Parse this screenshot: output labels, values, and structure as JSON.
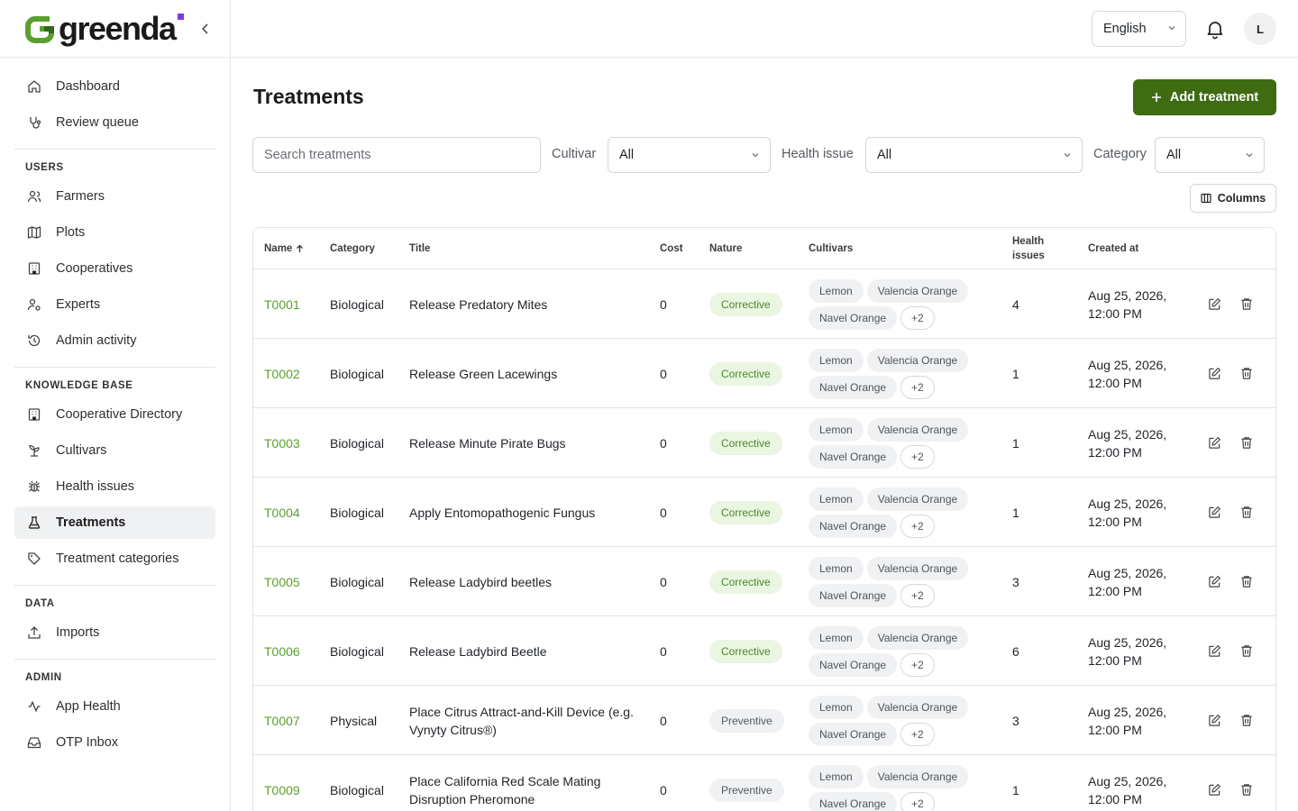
{
  "brand": {
    "name": "greenda"
  },
  "sidebar": {
    "top_items": [
      {
        "label": "Dashboard",
        "icon": "home-icon"
      },
      {
        "label": "Review queue",
        "icon": "stethoscope-icon"
      }
    ],
    "sections": [
      {
        "heading": "USERS",
        "items": [
          {
            "label": "Farmers",
            "icon": "users-icon"
          },
          {
            "label": "Plots",
            "icon": "map-icon"
          },
          {
            "label": "Cooperatives",
            "icon": "building-icon"
          },
          {
            "label": "Experts",
            "icon": "user-cog-icon"
          },
          {
            "label": "Admin activity",
            "icon": "history-icon"
          }
        ]
      },
      {
        "heading": "KNOWLEDGE BASE",
        "items": [
          {
            "label": "Cooperative Directory",
            "icon": "building-icon"
          },
          {
            "label": "Cultivars",
            "icon": "sprout-icon"
          },
          {
            "label": "Health issues",
            "icon": "bug-icon"
          },
          {
            "label": "Treatments",
            "icon": "flask-icon",
            "active": true
          },
          {
            "label": "Treatment categories",
            "icon": "tag-icon"
          }
        ]
      },
      {
        "heading": "DATA",
        "items": [
          {
            "label": "Imports",
            "icon": "upload-icon"
          }
        ]
      },
      {
        "heading": "ADMIN",
        "items": [
          {
            "label": "App Health",
            "icon": "activity-icon"
          },
          {
            "label": "OTP Inbox",
            "icon": "inbox-icon"
          }
        ]
      }
    ]
  },
  "topbar": {
    "language": "English",
    "avatar_initial": "L"
  },
  "page": {
    "title": "Treatments",
    "add_label": "Add treatment"
  },
  "filters": {
    "search_placeholder": "Search treatments",
    "cultivar_label": "Cultivar",
    "cultivar_value": "All",
    "health_label": "Health issue",
    "health_value": "All",
    "category_label": "Category",
    "category_value": "All",
    "columns_label": "Columns"
  },
  "table": {
    "headers": {
      "name": "Name",
      "category": "Category",
      "title": "Title",
      "cost": "Cost",
      "nature": "Nature",
      "cultivars": "Cultivars",
      "health": "Health issues",
      "created": "Created at"
    },
    "rows": [
      {
        "name": "T0001",
        "category": "Biological",
        "title": "Release Predatory Mites",
        "cost": "0",
        "nature": "Corrective",
        "cultivars": [
          "Lemon",
          "Valencia Orange",
          "Navel Orange"
        ],
        "more": "+2",
        "health": "4",
        "date": "Aug 25, 2026,",
        "time": "12:00 PM"
      },
      {
        "name": "T0002",
        "category": "Biological",
        "title": "Release Green Lacewings",
        "cost": "0",
        "nature": "Corrective",
        "cultivars": [
          "Lemon",
          "Valencia Orange",
          "Navel Orange"
        ],
        "more": "+2",
        "health": "1",
        "date": "Aug 25, 2026,",
        "time": "12:00 PM"
      },
      {
        "name": "T0003",
        "category": "Biological",
        "title": "Release Minute Pirate Bugs",
        "cost": "0",
        "nature": "Corrective",
        "cultivars": [
          "Lemon",
          "Valencia Orange",
          "Navel Orange"
        ],
        "more": "+2",
        "health": "1",
        "date": "Aug 25, 2026,",
        "time": "12:00 PM"
      },
      {
        "name": "T0004",
        "category": "Biological",
        "title": "Apply Entomopathogenic Fungus",
        "cost": "0",
        "nature": "Corrective",
        "cultivars": [
          "Lemon",
          "Valencia Orange",
          "Navel Orange"
        ],
        "more": "+2",
        "health": "1",
        "date": "Aug 25, 2026,",
        "time": "12:00 PM"
      },
      {
        "name": "T0005",
        "category": "Biological",
        "title": "Release Ladybird beetles",
        "cost": "0",
        "nature": "Corrective",
        "cultivars": [
          "Lemon",
          "Valencia Orange",
          "Navel Orange"
        ],
        "more": "+2",
        "health": "3",
        "date": "Aug 25, 2026,",
        "time": "12:00 PM"
      },
      {
        "name": "T0006",
        "category": "Biological",
        "title": "Release Ladybird Beetle",
        "cost": "0",
        "nature": "Corrective",
        "cultivars": [
          "Lemon",
          "Valencia Orange",
          "Navel Orange"
        ],
        "more": "+2",
        "health": "6",
        "date": "Aug 25, 2026,",
        "time": "12:00 PM"
      },
      {
        "name": "T0007",
        "category": "Physical",
        "title": "Place Citrus Attract-and-Kill Device (e.g. Vynyty Citrus®)",
        "cost": "0",
        "nature": "Preventive",
        "cultivars": [
          "Lemon",
          "Valencia Orange",
          "Navel Orange"
        ],
        "more": "+2",
        "health": "3",
        "date": "Aug 25, 2026,",
        "time": "12:00 PM"
      },
      {
        "name": "T0009",
        "category": "Biological",
        "title": "Place California Red Scale Mating Disruption Pheromone",
        "cost": "0",
        "nature": "Preventive",
        "cultivars": [
          "Lemon",
          "Valencia Orange",
          "Navel Orange"
        ],
        "more": "+2",
        "health": "1",
        "date": "Aug 25, 2026,",
        "time": "12:00 PM"
      }
    ]
  },
  "colors": {
    "primary": "#3f6b13",
    "link_green": "#5aa02c",
    "brand_purple": "#7c3aed"
  }
}
